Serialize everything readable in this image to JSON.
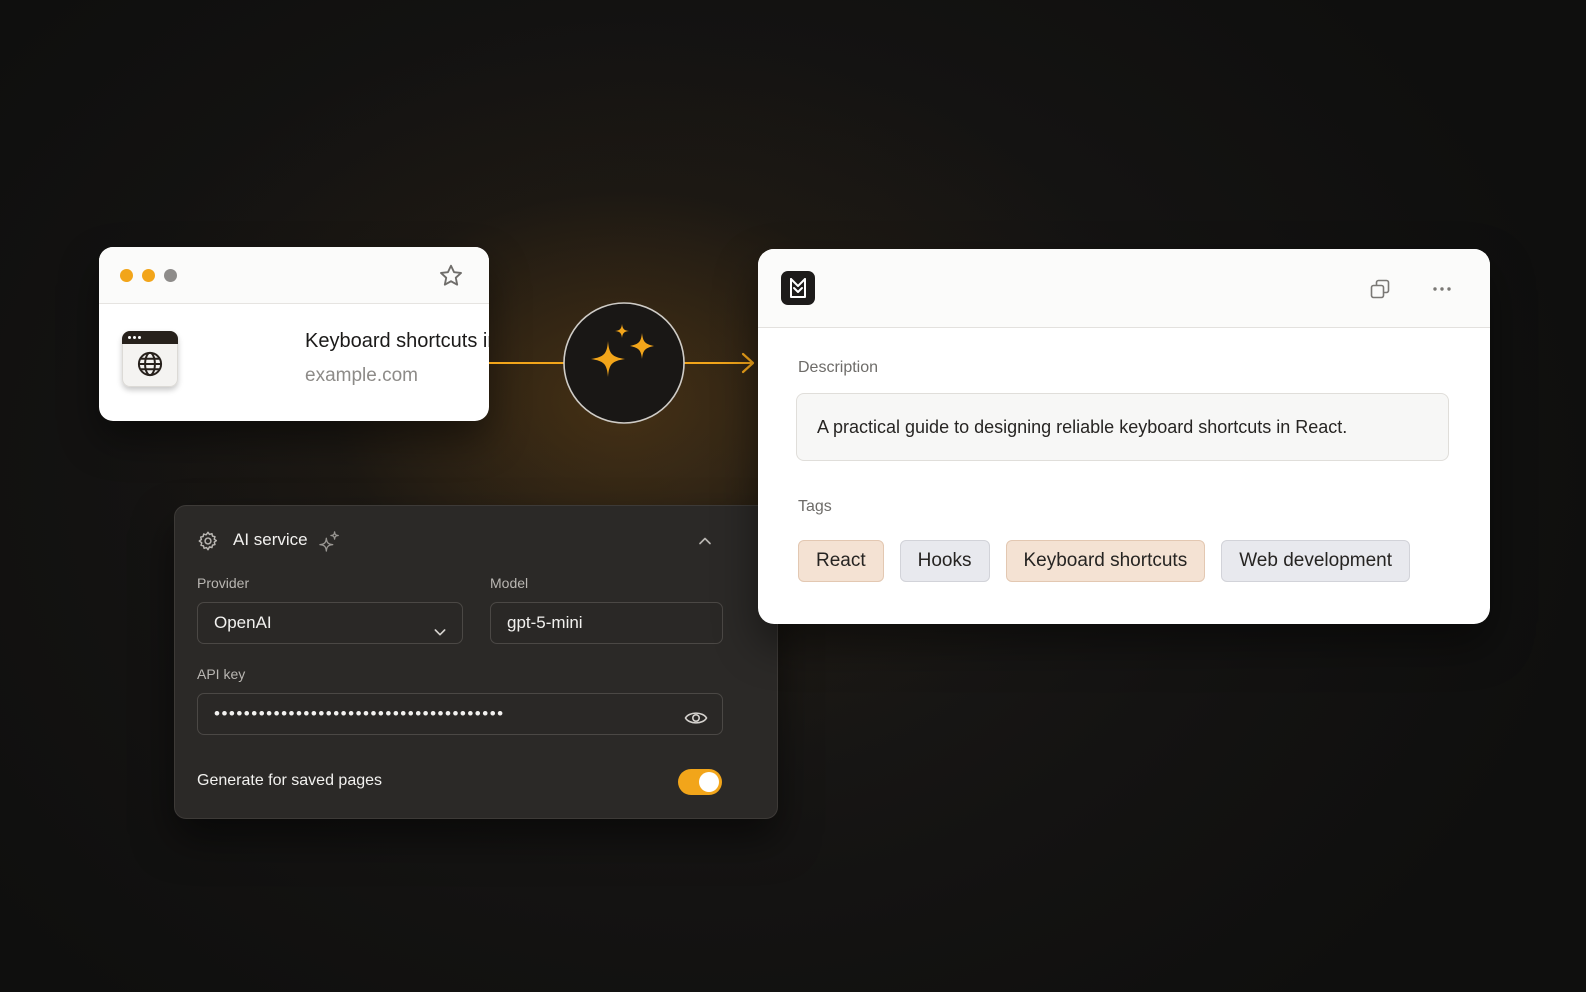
{
  "bookmark": {
    "title": "Keyboard shortcuts in React",
    "url": "example.com",
    "icons": {
      "favorite": "star-icon",
      "site": "globe-icon"
    },
    "window_dots": [
      "#f2a51a",
      "#f2a51a",
      "#8e8c8a"
    ]
  },
  "connector": {
    "icon": "sparkles-icon",
    "accent": "#f2a51a"
  },
  "ai_service": {
    "title": "AI service",
    "header_icon": "gear-icon",
    "title_icon": "sparkles-icon",
    "collapse_icon": "chevron-up-icon",
    "provider": {
      "label": "Provider",
      "value": "OpenAI"
    },
    "model": {
      "label": "Model",
      "value": "gpt-5-mini"
    },
    "api_key": {
      "label": "API key",
      "masked_value": "•••••••••••••••••••••••••••••••••••••••",
      "reveal_icon": "eye-icon"
    },
    "generate_toggle": {
      "label": "Generate for saved pages",
      "on": true
    }
  },
  "result": {
    "logo_icon": "app-logo-icon",
    "actions": [
      "copy-icon",
      "more-icon"
    ],
    "description": {
      "label": "Description",
      "text": "A practical guide to designing reliable keyboard shortcuts in React."
    },
    "tags": {
      "label": "Tags",
      "items": [
        "React",
        "Hooks",
        "Keyboard shortcuts",
        "Web development"
      ]
    }
  },
  "colors": {
    "accent": "#f2a51a",
    "background": "#131211",
    "panel": "#2b2927",
    "tag_warm": "#f4e2d3",
    "tag_cool": "#e8e9ee"
  }
}
